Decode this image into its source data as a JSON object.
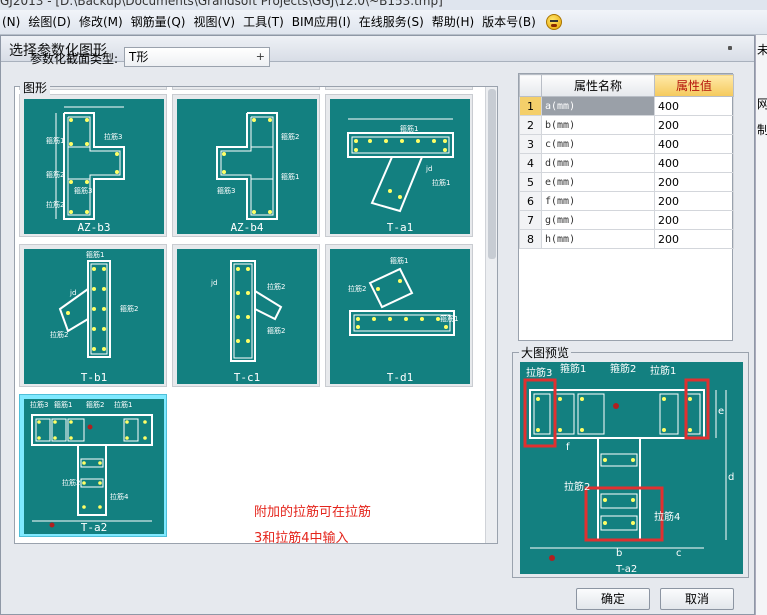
{
  "window": {
    "title": "GJ2013 - [D:\\Backup\\Documents\\Grandsoft Projects\\GGJ\\12.0\\~B153.tmp]"
  },
  "menu": [
    {
      "label": "(N)"
    },
    {
      "label": "绘图(D)"
    },
    {
      "label": "修改(M)"
    },
    {
      "label": "钢筋量(Q)"
    },
    {
      "label": "视图(V)"
    },
    {
      "label": "工具(T)"
    },
    {
      "label": "BIM应用(I)"
    },
    {
      "label": "在线服务(S)"
    },
    {
      "label": "帮助(H)"
    },
    {
      "label": "版本号(B)"
    }
  ],
  "dialog": {
    "title": "选择参数化图形",
    "section_type_label": "参数化截面类型:",
    "section_type_value": "T形",
    "graphics_group_label": "图形",
    "preview_label": "大图预览",
    "note_line1": "附加的拉筋可在拉筋",
    "note_line2": "3和拉筋4中输入",
    "ok_label": "确定",
    "cancel_label": "取消"
  },
  "tiles": [
    {
      "caption": "AZ-b3"
    },
    {
      "caption": "AZ-b4"
    },
    {
      "caption": "T-a1"
    },
    {
      "caption": "T-b1"
    },
    {
      "caption": "T-c1"
    },
    {
      "caption": "T-d1"
    },
    {
      "caption": "T-a2"
    }
  ],
  "drawing_labels": {
    "tie1": "拉筋1",
    "tie2": "拉筋2",
    "tie3": "拉筋3",
    "tie4": "拉筋4",
    "stir1": "箍筋1",
    "stir2": "箍筋2",
    "stir3": "箍筋3",
    "jd": "jd",
    "a": "a",
    "b": "b",
    "c": "c",
    "d": "d",
    "e": "e",
    "f": "f"
  },
  "properties": {
    "header_index": "",
    "header_name": "属性名称",
    "header_value": "属性值",
    "rows": [
      {
        "index": "1",
        "name": "a(mm)",
        "value": "400"
      },
      {
        "index": "2",
        "name": "b(mm)",
        "value": "200"
      },
      {
        "index": "3",
        "name": "c(mm)",
        "value": "400"
      },
      {
        "index": "4",
        "name": "d(mm)",
        "value": "400"
      },
      {
        "index": "5",
        "name": "e(mm)",
        "value": "200"
      },
      {
        "index": "6",
        "name": "f(mm)",
        "value": "200"
      },
      {
        "index": "7",
        "name": "g(mm)",
        "value": "200"
      },
      {
        "index": "8",
        "name": "h(mm)",
        "value": "200"
      }
    ]
  },
  "side_panel": {
    "text1": "未规",
    "text2": "网",
    "text3": "制标"
  },
  "colors": {
    "drawing_bg": "#138080",
    "highlight": "#e03030",
    "note": "#e4251c"
  }
}
